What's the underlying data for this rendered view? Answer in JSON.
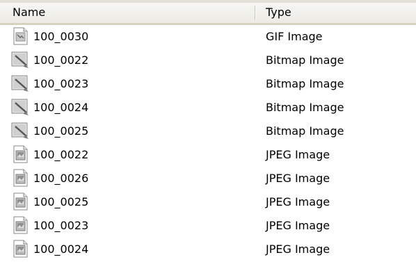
{
  "columns": {
    "name": "Name",
    "type": "Type"
  },
  "files": [
    {
      "name": "100_0030",
      "type": "GIF Image",
      "icon": "gif-file-icon"
    },
    {
      "name": "100_0022",
      "type": "Bitmap Image",
      "icon": "bitmap-file-icon"
    },
    {
      "name": "100_0023",
      "type": "Bitmap Image",
      "icon": "bitmap-file-icon"
    },
    {
      "name": "100_0024",
      "type": "Bitmap Image",
      "icon": "bitmap-file-icon"
    },
    {
      "name": "100_0025",
      "type": "Bitmap Image",
      "icon": "bitmap-file-icon"
    },
    {
      "name": "100_0022",
      "type": "JPEG Image",
      "icon": "jpeg-file-icon"
    },
    {
      "name": "100_0026",
      "type": "JPEG Image",
      "icon": "jpeg-file-icon"
    },
    {
      "name": "100_0025",
      "type": "JPEG Image",
      "icon": "jpeg-file-icon"
    },
    {
      "name": "100_0023",
      "type": "JPEG Image",
      "icon": "jpeg-file-icon"
    },
    {
      "name": "100_0024",
      "type": "JPEG Image",
      "icon": "jpeg-file-icon"
    }
  ]
}
